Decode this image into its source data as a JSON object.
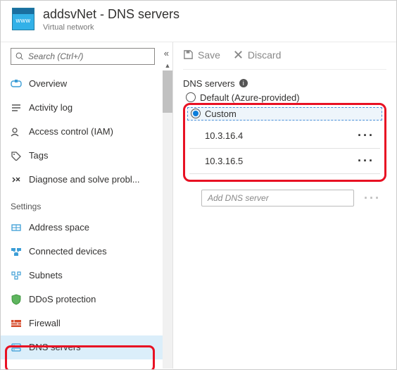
{
  "header": {
    "title": "addsvNet - DNS servers",
    "subtitle": "Virtual network"
  },
  "search": {
    "placeholder": "Search (Ctrl+/)"
  },
  "sidebar": {
    "items": [
      {
        "label": "Overview",
        "icon": "overview-icon"
      },
      {
        "label": "Activity log",
        "icon": "log-icon"
      },
      {
        "label": "Access control (IAM)",
        "icon": "iam-icon"
      },
      {
        "label": "Tags",
        "icon": "tag-icon"
      },
      {
        "label": "Diagnose and solve probl...",
        "icon": "diagnose-icon"
      }
    ],
    "settings_label": "Settings",
    "settings_items": [
      {
        "label": "Address space",
        "icon": "address-icon"
      },
      {
        "label": "Connected devices",
        "icon": "devices-icon"
      },
      {
        "label": "Subnets",
        "icon": "subnets-icon"
      },
      {
        "label": "DDoS protection",
        "icon": "ddos-icon"
      },
      {
        "label": "Firewall",
        "icon": "firewall-icon"
      },
      {
        "label": "DNS servers",
        "icon": "dns-icon",
        "selected": true
      }
    ]
  },
  "toolbar": {
    "save_label": "Save",
    "discard_label": "Discard"
  },
  "dns": {
    "label": "DNS servers",
    "option_default": "Default (Azure-provided)",
    "option_custom": "Custom",
    "servers": [
      "10.3.16.4",
      "10.3.16.5"
    ],
    "add_placeholder": "Add DNS server"
  }
}
